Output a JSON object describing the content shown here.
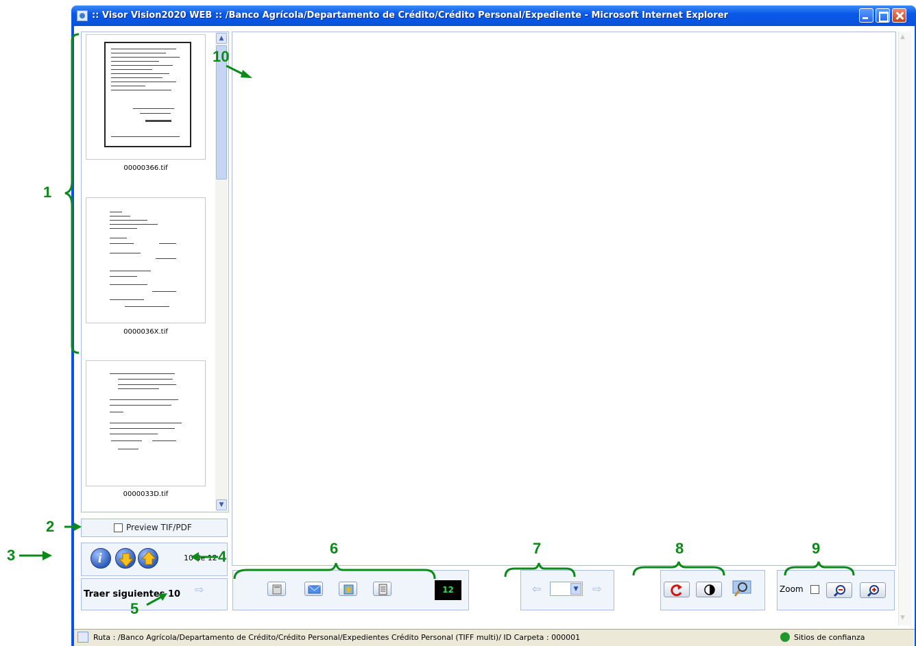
{
  "window": {
    "title": ":: Visor Vision2020 WEB ::  /Banco Agrícola/Departamento de Crédito/Crédito Personal/Expediente - Microsoft Internet Explorer"
  },
  "thumbnails": [
    {
      "filename": "00000366.tif"
    },
    {
      "filename": "0000036X.tif"
    },
    {
      "filename": "0000033D.tif"
    }
  ],
  "preview": {
    "label": "Preview TIF/PDF",
    "checked": false
  },
  "info_panel": {
    "counter": "10 de 12"
  },
  "fetch_panel": {
    "label": "Traer siguientes 10"
  },
  "toolbar_docs": {
    "count": "12"
  },
  "toolbar_zoom": {
    "label": "Zoom"
  },
  "status_bar": {
    "path": "Ruta :  /Banco Agrícola/Departamento de Crédito/Crédito Personal/Expedientes Crédito Personal (TIFF multi)/ ID Carpeta : 000001",
    "zone": "Sitios de confianza"
  },
  "annotations": [
    "1",
    "2",
    "3",
    "4",
    "5",
    "6",
    "7",
    "8",
    "9",
    "10"
  ],
  "colors": {
    "annotation": "#0a8a16",
    "title_bar": "#0a59e8",
    "panel_border": "#a7bde3"
  }
}
